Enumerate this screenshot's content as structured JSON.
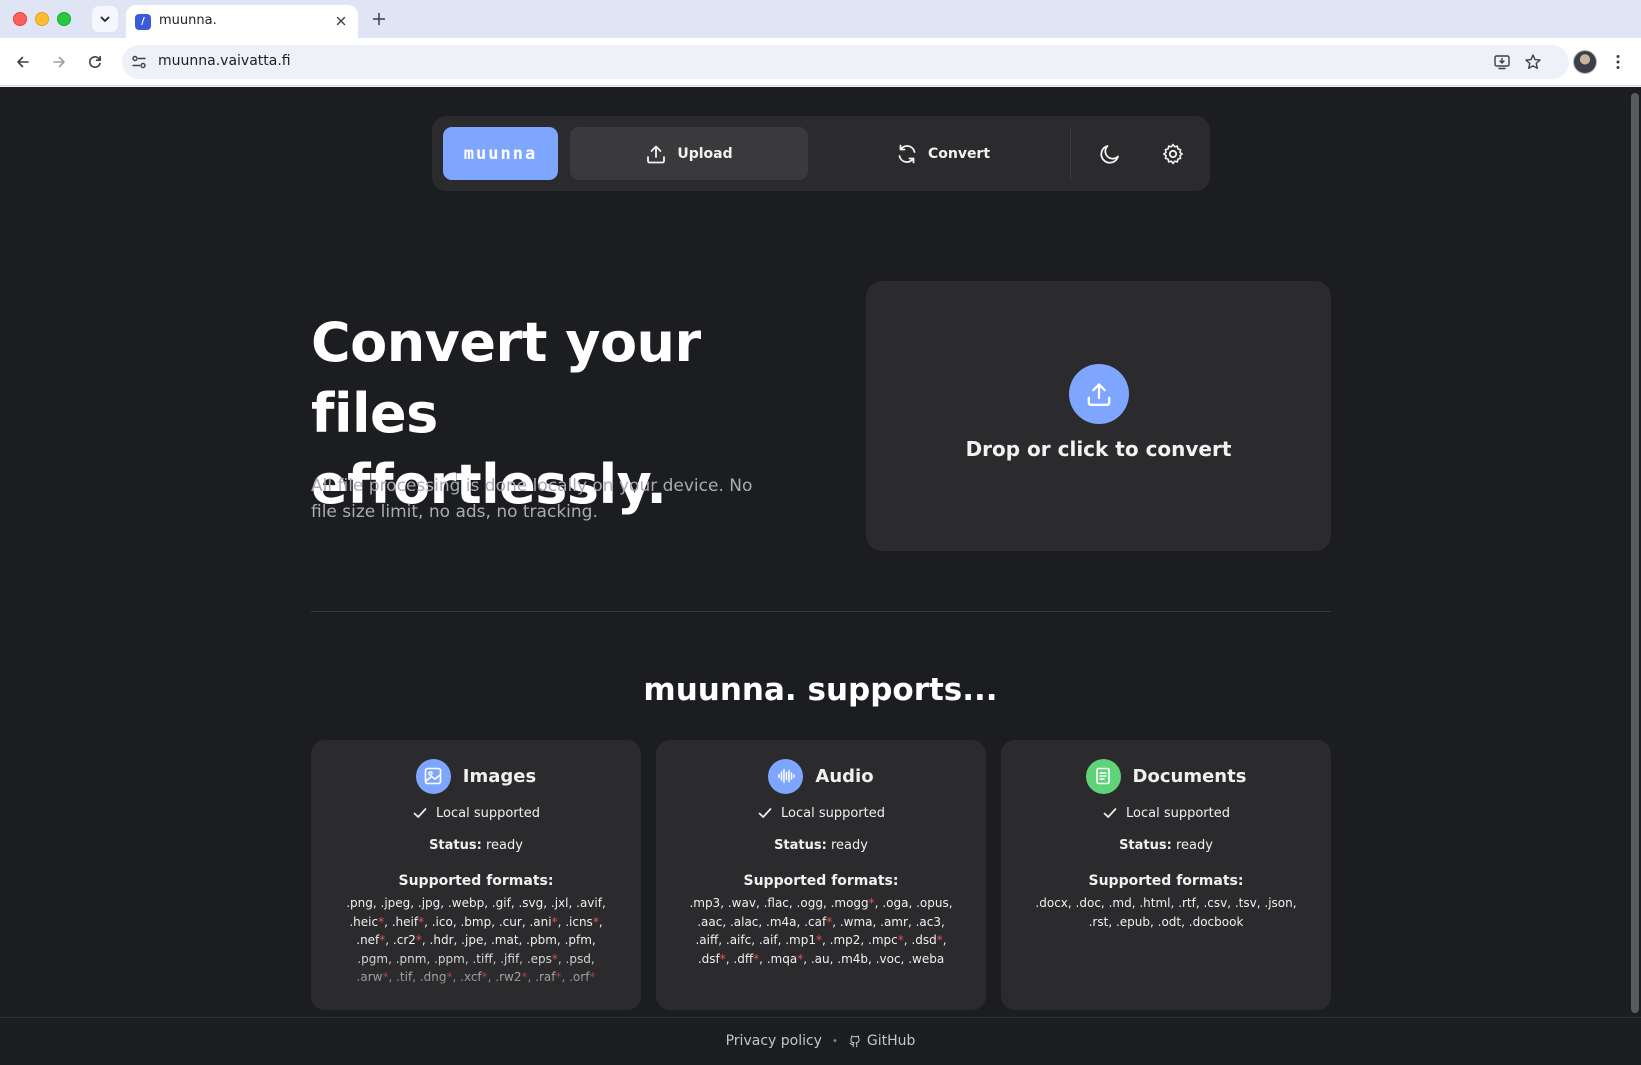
{
  "browser": {
    "tab_title": "muunna.",
    "tab_favicon": "/",
    "url": "muunna.vaivatta.fi"
  },
  "nav": {
    "brand": "muunna",
    "upload_label": "Upload",
    "convert_label": "Convert"
  },
  "hero": {
    "title_line1": "Convert your files",
    "title_line2": "effortlessly.",
    "subtitle": "All file processing is done locally on your device. No file size limit, no ads, no tracking."
  },
  "dropzone": {
    "label": "Drop or click to convert"
  },
  "supports": {
    "title": "muunna. supports...",
    "cards": [
      {
        "title": "Images",
        "local": "Local supported",
        "status_label": "Status:",
        "status_value": "ready",
        "formats_label": "Supported formats:",
        "icon": "image-icon",
        "accent": "#7fa6ff",
        "formats": [
          [
            ".png",
            false
          ],
          [
            ".jpeg",
            false
          ],
          [
            ".jpg",
            false
          ],
          [
            ".webp",
            false
          ],
          [
            ".gif",
            false
          ],
          [
            ".svg",
            false
          ],
          [
            ".jxl",
            false
          ],
          [
            ".avif",
            false
          ],
          [
            ".heic",
            true
          ],
          [
            ".heif",
            true
          ],
          [
            ".ico",
            false
          ],
          [
            ".bmp",
            false
          ],
          [
            ".cur",
            false
          ],
          [
            ".ani",
            true
          ],
          [
            ".icns",
            true
          ],
          [
            ".nef",
            true
          ],
          [
            ".cr2",
            true
          ],
          [
            ".hdr",
            false
          ],
          [
            ".jpe",
            false
          ],
          [
            ".mat",
            false
          ],
          [
            ".pbm",
            false
          ],
          [
            ".pfm",
            false
          ],
          [
            ".pgm",
            false
          ],
          [
            ".pnm",
            false
          ],
          [
            ".ppm",
            false
          ],
          [
            ".tiff",
            false
          ],
          [
            ".jfif",
            false
          ],
          [
            ".eps",
            true
          ],
          [
            ".psd",
            false
          ],
          [
            ".arw",
            true
          ],
          [
            ".tif",
            false
          ],
          [
            ".dng",
            true
          ],
          [
            ".xcf",
            true
          ],
          [
            ".rw2",
            true
          ],
          [
            ".raf",
            true
          ],
          [
            ".orf",
            true
          ]
        ]
      },
      {
        "title": "Audio",
        "local": "Local supported",
        "status_label": "Status:",
        "status_value": "ready",
        "formats_label": "Supported formats:",
        "icon": "audio-wave-icon",
        "accent": "#7fa6ff",
        "formats": [
          [
            ".mp3",
            false
          ],
          [
            ".wav",
            false
          ],
          [
            ".flac",
            false
          ],
          [
            ".ogg",
            false
          ],
          [
            ".mogg",
            true
          ],
          [
            ".oga",
            false
          ],
          [
            ".opus",
            false
          ],
          [
            ".aac",
            false
          ],
          [
            ".alac",
            false
          ],
          [
            ".m4a",
            false
          ],
          [
            ".caf",
            true
          ],
          [
            ".wma",
            false
          ],
          [
            ".amr",
            false
          ],
          [
            ".ac3",
            false
          ],
          [
            ".aiff",
            false
          ],
          [
            ".aifc",
            false
          ],
          [
            ".aif",
            false
          ],
          [
            ".mp1",
            true
          ],
          [
            ".mp2",
            false
          ],
          [
            ".mpc",
            true
          ],
          [
            ".dsd",
            true
          ],
          [
            ".dsf",
            true
          ],
          [
            ".dff",
            true
          ],
          [
            ".mqa",
            true
          ],
          [
            ".au",
            false
          ],
          [
            ".m4b",
            false
          ],
          [
            ".voc",
            false
          ],
          [
            ".weba",
            false
          ]
        ]
      },
      {
        "title": "Documents",
        "local": "Local supported",
        "status_label": "Status:",
        "status_value": "ready",
        "formats_label": "Supported formats:",
        "icon": "document-icon",
        "accent": "#5fd27a",
        "formats": [
          [
            ".docx",
            false
          ],
          [
            ".doc",
            false
          ],
          [
            ".md",
            false
          ],
          [
            ".html",
            false
          ],
          [
            ".rtf",
            false
          ],
          [
            ".csv",
            false
          ],
          [
            ".tsv",
            false
          ],
          [
            ".json",
            false
          ],
          [
            ".rst",
            false
          ],
          [
            ".epub",
            false
          ],
          [
            ".odt",
            false
          ],
          [
            ".docbook",
            false
          ]
        ]
      }
    ]
  },
  "footer": {
    "privacy": "Privacy policy",
    "separator": "•",
    "github": "GitHub"
  }
}
